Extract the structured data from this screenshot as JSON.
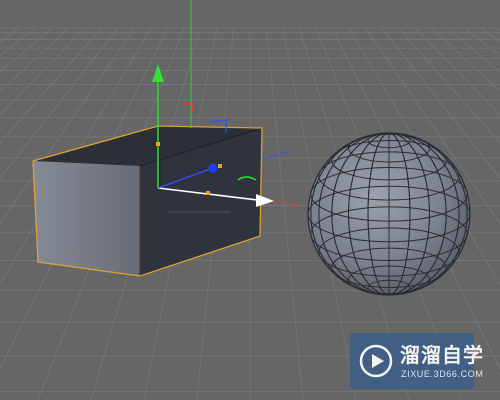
{
  "viewport": {
    "background_color": "#666666",
    "grid_line_color": "#787878",
    "selection_outline_color": "#e0a030",
    "axis_colors": {
      "x": "#ff3030",
      "y": "#30d030",
      "z": "#3050ff"
    }
  },
  "scene": {
    "objects": [
      {
        "name": "cube",
        "type": "box",
        "selected": true,
        "face_color": "#2e323b"
      },
      {
        "name": "sphere",
        "type": "sphere",
        "selected": false,
        "face_color": "#7d8391"
      }
    ],
    "gizmo": {
      "type": "move-manipulator",
      "axes": [
        "x",
        "y",
        "z"
      ]
    }
  },
  "watermark": {
    "title": "溜溜自学",
    "url": "ZIXUE.3D66.COM",
    "logo_icon": "play-icon",
    "background": "#3f5f86"
  }
}
